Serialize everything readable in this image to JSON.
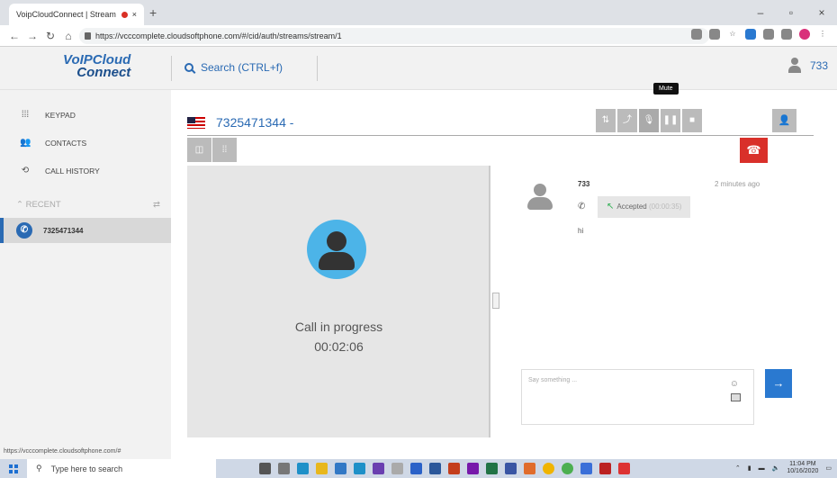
{
  "browser": {
    "tab_title": "VoipCloudConnect | Stream",
    "url": "https://vcccomplete.cloudsoftphone.com/#/cid/auth/streams/stream/1",
    "status_url": "https://vcccomplete.cloudsoftphone.com/#"
  },
  "header": {
    "logo_line1": "VoIPCloud",
    "logo_line2": "Connect",
    "search_label": "Search (CTRL+f)",
    "user_ext": "733"
  },
  "sidebar": {
    "items": [
      {
        "label": "KEYPAD"
      },
      {
        "label": "CONTACTS"
      },
      {
        "label": "CALL HISTORY"
      }
    ],
    "recent_label": "RECENT",
    "recent_item": "7325471344"
  },
  "call": {
    "number": "7325471344 -",
    "status": "Call in progress",
    "timer": "00:02:06",
    "tooltip": "Mute"
  },
  "chat": {
    "sender": "733",
    "time": "2 minutes ago",
    "accepted_label": "Accepted",
    "accepted_duration": "(00:00:35)",
    "message": "hi",
    "input_placeholder": "Say something ..."
  },
  "taskbar": {
    "search_placeholder": "Type here to search",
    "time": "11:04 PM",
    "date": "10/16/2020"
  },
  "colors": {
    "accent": "#2a6ab3",
    "hangup": "#d9302a",
    "send": "#2a79d0",
    "avatar_bg": "#4cb4e8"
  }
}
